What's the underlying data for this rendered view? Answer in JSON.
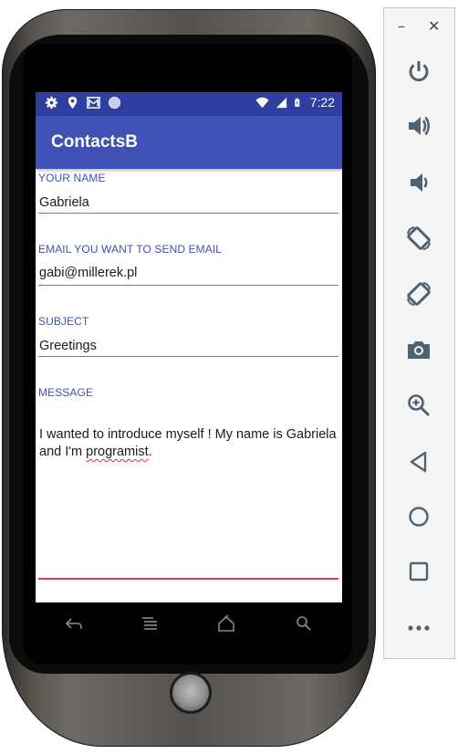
{
  "app": {
    "title": "ContactsB"
  },
  "status_bar": {
    "time": "7:22",
    "left_icons": [
      "gear-icon",
      "location-pin-icon",
      "gmail-icon",
      "sync-circle-icon"
    ],
    "right_icons": [
      "wifi-icon",
      "signal-icon",
      "battery-charging-icon"
    ]
  },
  "form": {
    "name": {
      "label": "YOUR NAME",
      "value": "Gabriela"
    },
    "email": {
      "label": "EMAIL YOU WANT TO SEND EMAIL",
      "value": "gabi@millerek.pl"
    },
    "subject": {
      "label": "SUBJECT",
      "value": "Greetings"
    },
    "message": {
      "label": "MESSAGE",
      "line1": "I wanted to introduce myself ! My name is Gabriela",
      "line2_before": "and I'm ",
      "line2_misspelled": "programist",
      "line2_after": "."
    }
  },
  "nav_buttons": [
    "back-icon",
    "menu-icon",
    "home-icon",
    "search-icon"
  ],
  "emulator_toolbar": {
    "minimize": "–",
    "close": "✕",
    "buttons": [
      "power-icon",
      "volume-up-icon",
      "volume-down-icon",
      "rotate-left-icon",
      "rotate-right-icon",
      "camera-icon",
      "zoom-icon",
      "back-triangle-icon",
      "home-circle-icon",
      "overview-square-icon",
      "more-icon"
    ]
  },
  "colors": {
    "primary": "#3f51b5",
    "primary_dark": "#2f3fa0",
    "accent": "#e8336c",
    "toolbar_icon": "#4f6270"
  }
}
